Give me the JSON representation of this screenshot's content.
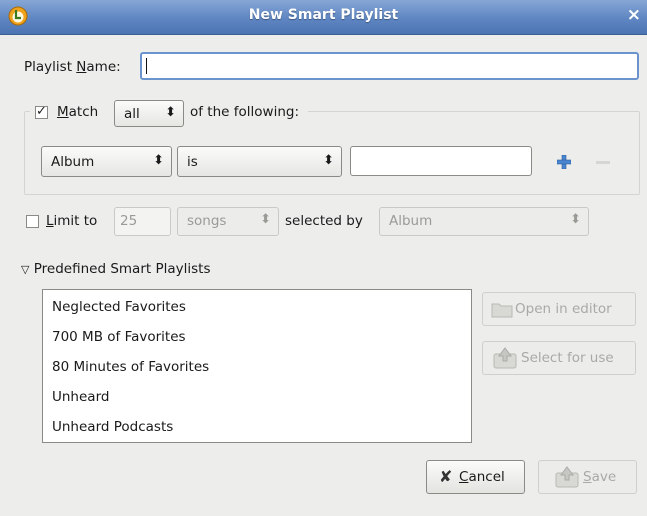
{
  "window": {
    "title": "New Smart Playlist",
    "title_bar_color": "#5f86c2",
    "icons": {
      "app": "app-logo-icon",
      "close": "close-icon"
    }
  },
  "playlist_name": {
    "label_prefix": "Playlist ",
    "label_mnemonic": "N",
    "label_suffix": "ame:",
    "value": ""
  },
  "match": {
    "checked": true,
    "label_mnemonic": "M",
    "label_suffix": "atch",
    "mode": "all",
    "suffix_text": "of the following:",
    "rule": {
      "field": "Album",
      "operator": "is",
      "value": ""
    },
    "add_icon": "plus-icon",
    "remove_icon": "minus-icon"
  },
  "limit": {
    "checked": false,
    "label_mnemonic": "L",
    "label_suffix": "imit to",
    "count": "25",
    "unit": "songs",
    "selected_by_label": "selected by",
    "selected_by": "Album"
  },
  "predefined": {
    "expander_label": "Predefined Smart Playlists",
    "expanded": true,
    "items": [
      "Neglected Favorites",
      "700 MB of Favorites",
      "80 Minutes of Favorites",
      "Unheard",
      "Unheard Podcasts"
    ],
    "open_editor_label": "Open in editor",
    "select_for_use_label": "Select for use"
  },
  "footer": {
    "cancel_mnemonic": "C",
    "cancel_suffix": "ancel",
    "save_mnemonic": "S",
    "save_suffix": "ave"
  }
}
